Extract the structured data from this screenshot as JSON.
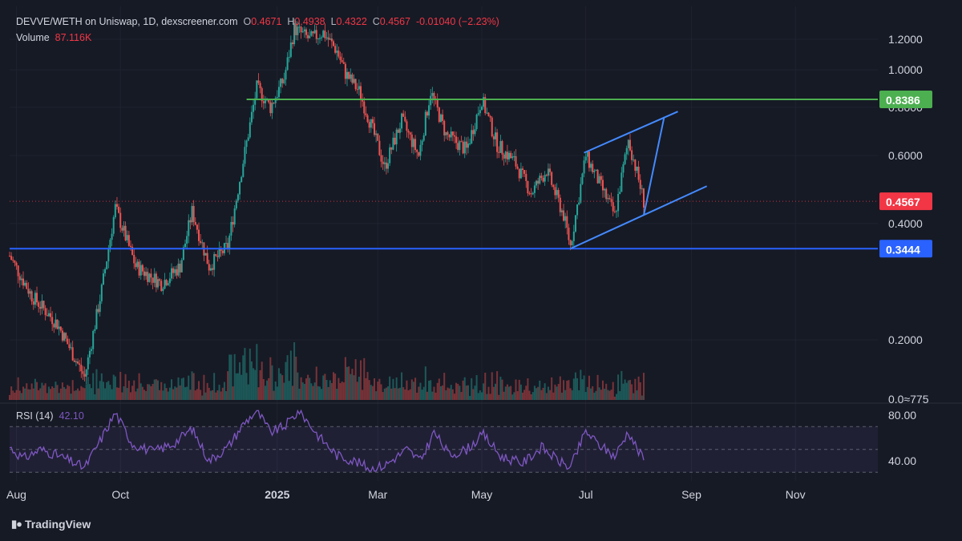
{
  "header": {
    "title": "DEVVE/WETH on Uniswap, 1D, dexscreener.com",
    "open_label": "O",
    "open": "0.4671",
    "high_label": "H",
    "high": "0.4938",
    "low_label": "L",
    "low": "0.4322",
    "close_label": "C",
    "close": "0.4567",
    "change": "-0.01040 (−2.23%)"
  },
  "volume": {
    "label": "Volume",
    "value": "87.116K"
  },
  "rsi": {
    "label": "RSI (14)",
    "value": "42.10"
  },
  "branding": {
    "name": "TradingView",
    "icon": "tradingview-logo-icon"
  },
  "colors": {
    "background": "#161a25",
    "up": "#26a69a",
    "down": "#ef5350",
    "support_line": "#2962ff",
    "resistance_line": "#4caf50",
    "pattern_line": "#448aff",
    "rsi_line": "#7e57c2",
    "price_tag": "#f23645"
  },
  "chart_data": [
    {
      "type": "candlestick",
      "title": "DEVVE/WETH on Uniswap, 1D, dexscreener.com",
      "y_scale": "log",
      "ylim": [
        0.12,
        1.28
      ],
      "y_ticks": [
        "1.2000",
        "1.0000",
        "0.8000",
        "0.6000",
        "0.4000",
        "0.2000"
      ],
      "x_ticks": [
        "Aug",
        "Oct",
        "2025",
        "Mar",
        "May",
        "Jul",
        "Sep",
        "Nov"
      ],
      "price_path": [
        [
          "2024-07-28",
          0.33
        ],
        [
          "2024-08-10",
          0.26
        ],
        [
          "2024-08-25",
          0.22
        ],
        [
          "2024-09-10",
          0.16
        ],
        [
          "2024-09-20",
          0.27
        ],
        [
          "2024-09-28",
          0.44
        ],
        [
          "2024-10-10",
          0.31
        ],
        [
          "2024-10-25",
          0.28
        ],
        [
          "2024-11-05",
          0.31
        ],
        [
          "2024-11-12",
          0.43
        ],
        [
          "2024-11-22",
          0.31
        ],
        [
          "2024-12-03",
          0.35
        ],
        [
          "2024-12-10",
          0.52
        ],
        [
          "2024-12-20",
          0.9
        ],
        [
          "2024-12-28",
          0.8
        ],
        [
          "2025-01-05",
          0.95
        ],
        [
          "2025-01-11",
          1.28
        ],
        [
          "2025-01-20",
          1.2
        ],
        [
          "2025-01-28",
          1.25
        ],
        [
          "2025-02-05",
          1.12
        ],
        [
          "2025-02-10",
          0.98
        ],
        [
          "2025-02-18",
          0.88
        ],
        [
          "2025-02-25",
          0.72
        ],
        [
          "2025-03-05",
          0.56
        ],
        [
          "2025-03-15",
          0.74
        ],
        [
          "2025-03-25",
          0.6
        ],
        [
          "2025-04-01",
          0.88
        ],
        [
          "2025-04-10",
          0.68
        ],
        [
          "2025-04-22",
          0.62
        ],
        [
          "2025-05-01",
          0.84
        ],
        [
          "2025-05-10",
          0.64
        ],
        [
          "2025-05-20",
          0.58
        ],
        [
          "2025-05-30",
          0.48
        ],
        [
          "2025-06-08",
          0.55
        ],
        [
          "2025-06-18",
          0.42
        ],
        [
          "2025-06-22",
          0.35
        ],
        [
          "2025-07-01",
          0.6
        ],
        [
          "2025-07-08",
          0.52
        ],
        [
          "2025-07-18",
          0.42
        ],
        [
          "2025-07-26",
          0.66
        ],
        [
          "2025-08-01",
          0.52
        ],
        [
          "2025-08-04",
          0.4567
        ]
      ],
      "levels": [
        {
          "price": 0.8386,
          "label": "0.8386",
          "color": "#4caf50",
          "from": "2024-12-14"
        },
        {
          "price": 0.3444,
          "label": "0.3444",
          "color": "#2962ff",
          "from": "2024-07-28"
        },
        {
          "price": 0.4567,
          "label": "0.4567",
          "color": "#f23645",
          "dotted": true,
          "from": "2024-07-28"
        }
      ],
      "pattern_lines": [
        [
          [
            "2025-06-22",
            0.3444
          ],
          [
            "2025-09-10",
            0.5
          ]
        ],
        [
          [
            "2025-06-30",
            0.61
          ],
          [
            "2025-08-24",
            0.78
          ]
        ],
        [
          [
            "2025-08-04",
            0.42
          ],
          [
            "2025-08-16",
            0.755
          ]
        ]
      ]
    },
    {
      "type": "bar",
      "name": "Volume",
      "last_value": "87.116K",
      "y_tick_text": "0.0≈775"
    },
    {
      "type": "line",
      "name": "RSI (14)",
      "last_value": 42.1,
      "ylim": [
        30,
        85
      ],
      "y_ticks": [
        "80.00",
        "40.00"
      ],
      "bands": [
        70,
        50,
        30
      ],
      "rsi_path": [
        [
          "2024-07-28",
          52
        ],
        [
          "2024-08-05",
          42
        ],
        [
          "2024-08-15",
          50
        ],
        [
          "2024-08-25",
          45
        ],
        [
          "2024-09-10",
          34
        ],
        [
          "2024-09-20",
          60
        ],
        [
          "2024-09-28",
          82
        ],
        [
          "2024-10-08",
          55
        ],
        [
          "2024-10-20",
          48
        ],
        [
          "2024-11-01",
          55
        ],
        [
          "2024-11-12",
          68
        ],
        [
          "2024-11-22",
          40
        ],
        [
          "2024-12-03",
          52
        ],
        [
          "2024-12-12",
          72
        ],
        [
          "2024-12-20",
          84
        ],
        [
          "2024-12-28",
          65
        ],
        [
          "2025-01-05",
          70
        ],
        [
          "2025-01-14",
          84
        ],
        [
          "2025-01-25",
          62
        ],
        [
          "2025-02-05",
          45
        ],
        [
          "2025-02-15",
          40
        ],
        [
          "2025-02-25",
          33
        ],
        [
          "2025-03-05",
          36
        ],
        [
          "2025-03-18",
          50
        ],
        [
          "2025-03-26",
          40
        ],
        [
          "2025-04-03",
          65
        ],
        [
          "2025-04-12",
          45
        ],
        [
          "2025-04-22",
          50
        ],
        [
          "2025-05-02",
          63
        ],
        [
          "2025-05-12",
          44
        ],
        [
          "2025-05-25",
          38
        ],
        [
          "2025-06-05",
          52
        ],
        [
          "2025-06-15",
          40
        ],
        [
          "2025-06-22",
          34
        ],
        [
          "2025-07-01",
          66
        ],
        [
          "2025-07-08",
          55
        ],
        [
          "2025-07-18",
          44
        ],
        [
          "2025-07-26",
          66
        ],
        [
          "2025-08-01",
          48
        ],
        [
          "2025-08-04",
          42.1
        ]
      ]
    }
  ]
}
